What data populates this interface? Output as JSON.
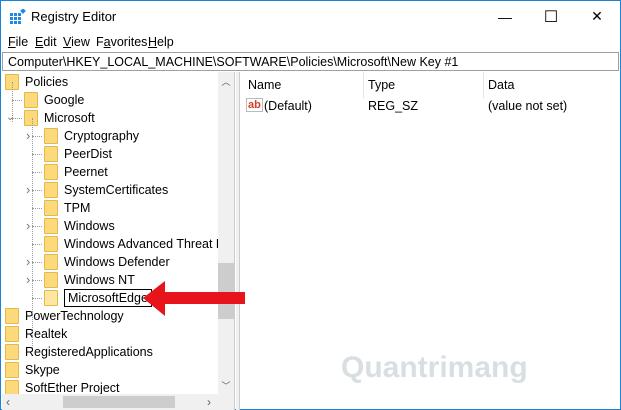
{
  "window": {
    "title": "Registry Editor",
    "minimize": "—",
    "maximize": "☐",
    "close": "✕"
  },
  "menu": [
    {
      "label": "File",
      "key": "F",
      "rest": "ile"
    },
    {
      "label": "Edit",
      "key": "E",
      "rest": "dit"
    },
    {
      "label": "View",
      "key": "V",
      "rest": "iew"
    },
    {
      "label": "Favorites",
      "key": "F",
      "rest": "avorites",
      "pre": "",
      "special": "a"
    },
    {
      "label": "Help",
      "key": "H",
      "rest": "elp"
    }
  ],
  "address": "Computer\\HKEY_LOCAL_MACHINE\\SOFTWARE\\Policies\\Microsoft\\New Key #1",
  "tree": [
    {
      "label": "Policies",
      "level": 0
    },
    {
      "label": "Google",
      "level": 1
    },
    {
      "label": "Microsoft",
      "level": 1,
      "expanded": true
    },
    {
      "label": "Cryptography",
      "level": 2,
      "expandable": true
    },
    {
      "label": "PeerDist",
      "level": 2
    },
    {
      "label": "Peernet",
      "level": 2
    },
    {
      "label": "SystemCertificates",
      "level": 2,
      "expandable": true
    },
    {
      "label": "TPM",
      "level": 2
    },
    {
      "label": "Windows",
      "level": 2,
      "expandable": true
    },
    {
      "label": "Windows Advanced Threat Pr",
      "level": 2
    },
    {
      "label": "Windows Defender",
      "level": 2,
      "expandable": true
    },
    {
      "label": "Windows NT",
      "level": 2,
      "expandable": true
    },
    {
      "label": "MicrosoftEdge",
      "level": 2,
      "editing": true
    },
    {
      "label": "PowerTechnology",
      "level": 0
    },
    {
      "label": "Realtek",
      "level": 0
    },
    {
      "label": "RegisteredApplications",
      "level": 0
    },
    {
      "label": "Skype",
      "level": 0
    },
    {
      "label": "SoftEther Project",
      "level": 0
    }
  ],
  "list": {
    "headers": [
      "Name",
      "Type",
      "Data"
    ],
    "rows": [
      {
        "name": "(Default)",
        "type": "REG_SZ",
        "data": "(value not set)",
        "icon": "string-value-icon"
      }
    ]
  },
  "annotation": {
    "arrow_color": "#e8141b",
    "points_to": "MicrosoftEdge"
  },
  "watermark": "Quantrimang",
  "colors": {
    "accent": "#1883d7",
    "folder": "#fcd97a"
  }
}
